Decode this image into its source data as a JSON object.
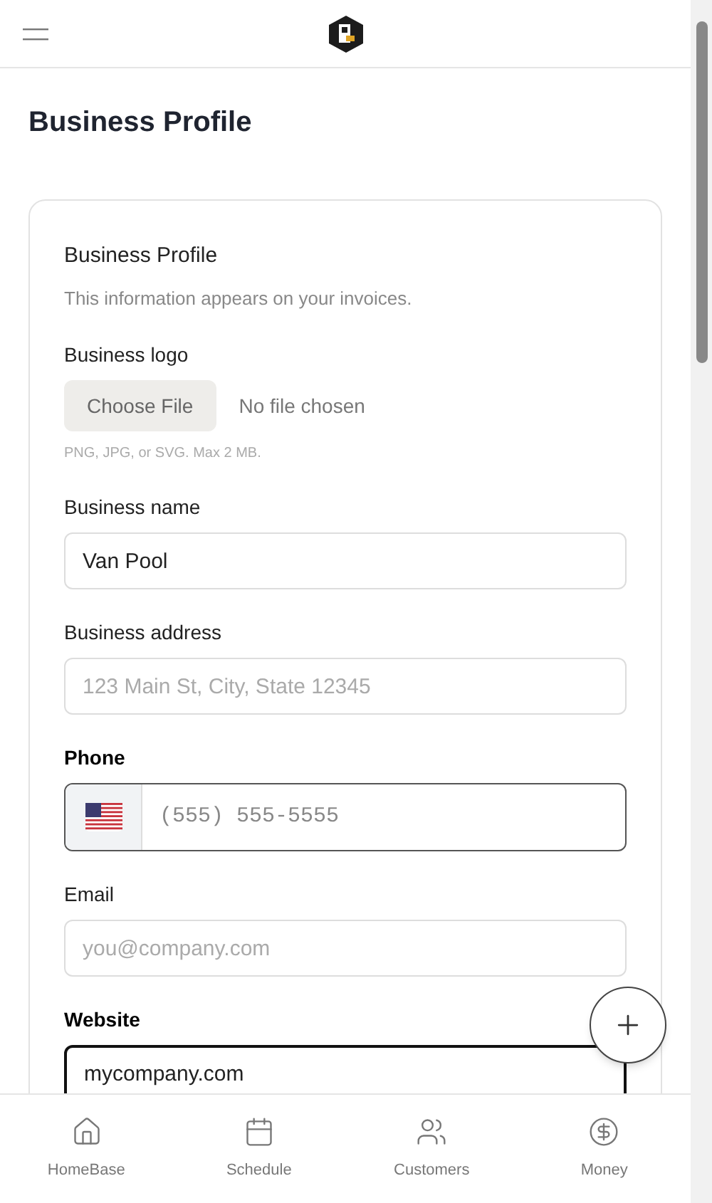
{
  "page": {
    "title": "Business Profile"
  },
  "card": {
    "title": "Business Profile",
    "subtitle": "This information appears on your invoices."
  },
  "fields": [
    {
      "kind": "file",
      "label": "Business logo",
      "button": "Choose File",
      "status": "No file chosen",
      "hint": "PNG, JPG, or SVG. Max 2 MB."
    },
    {
      "kind": "text",
      "label": "Business name",
      "value": "Van Pool",
      "focused": false
    },
    {
      "kind": "text",
      "label": "Business address",
      "placeholder": "123 Main St, City, State 12345",
      "focused": false
    },
    {
      "kind": "phone",
      "label": "Phone",
      "placeholder": "(555) 555-5555",
      "focused": true
    },
    {
      "kind": "text",
      "label": "Email",
      "placeholder": "you@company.com",
      "focused": false
    },
    {
      "kind": "text",
      "label": "Website",
      "value": "mycompany.com",
      "focused": true
    }
  ],
  "nav": [
    {
      "kind": "home",
      "label": "HomeBase",
      "selected": false
    },
    {
      "kind": "calendar",
      "label": "Schedule",
      "selected": false
    },
    {
      "kind": "people",
      "label": "Customers",
      "selected": false
    },
    {
      "kind": "money",
      "label": "Money",
      "selected": false
    }
  ]
}
